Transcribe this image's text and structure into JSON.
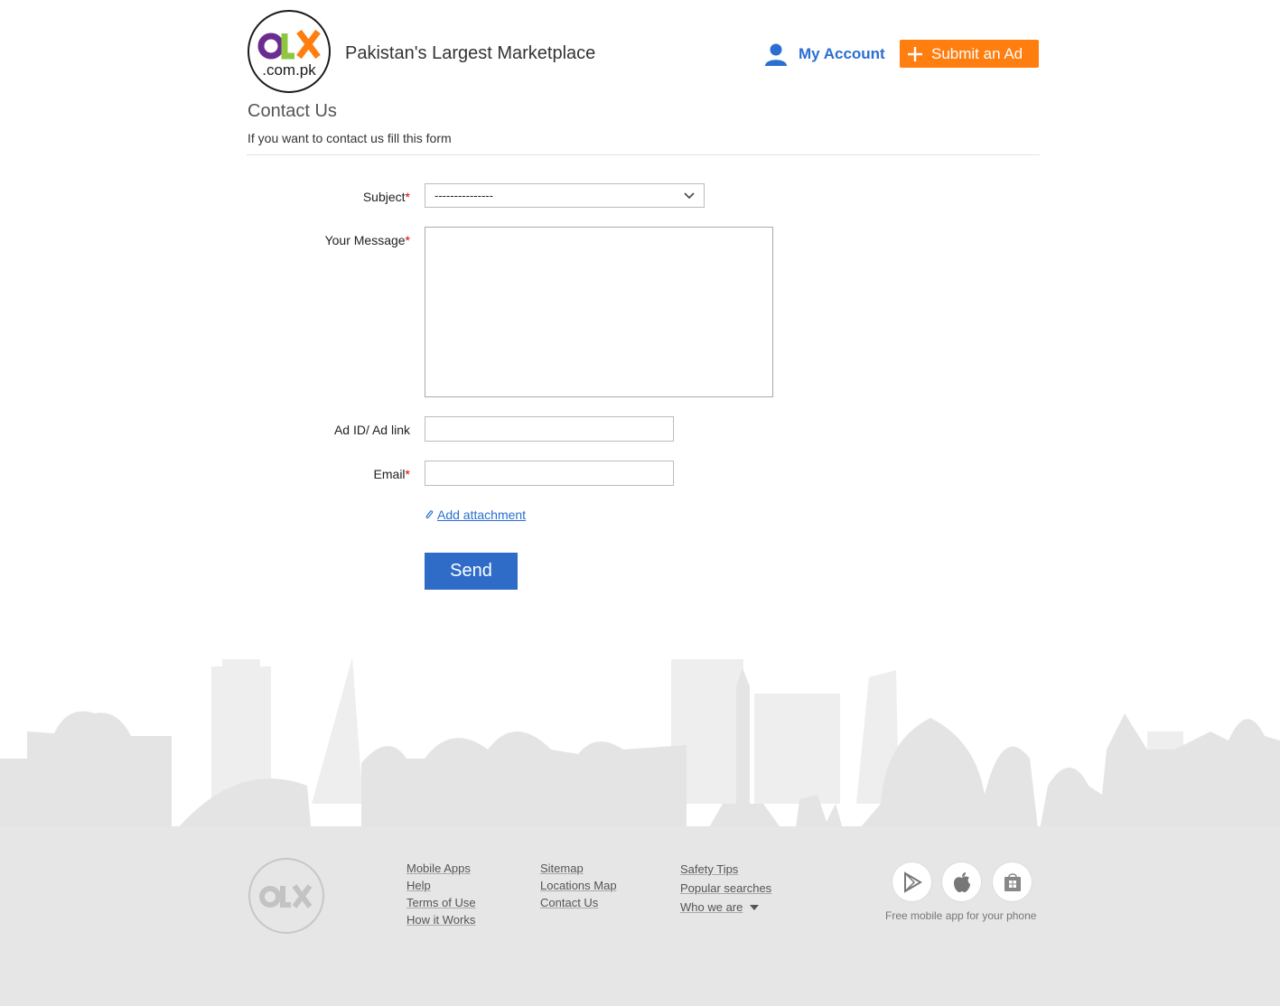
{
  "header": {
    "logo_brand": "OLX",
    "logo_domain": ".com.pk",
    "tagline": "Pakistan's Largest Marketplace",
    "account_label": "My Account",
    "account_icon": "user-icon",
    "submit_label": "Submit an Ad",
    "submit_icon": "plus-icon"
  },
  "page": {
    "title": "Contact Us",
    "subtitle": "If you want to contact us fill this form"
  },
  "form": {
    "subject_label": "Subject",
    "subject_value": "---------------",
    "message_label": "Your Message",
    "adid_label": "Ad ID/ Ad link",
    "email_label": "Email",
    "required_mark": "*",
    "attachment_label": "Add attachment",
    "send_label": "Send"
  },
  "footer": {
    "col1": [
      "Mobile Apps",
      "Help",
      "Terms of Use",
      "How it Works"
    ],
    "col2": [
      "Sitemap",
      "Locations Map",
      "Contact Us"
    ],
    "col3": [
      "Safety Tips",
      "Popular searches",
      "Who we are"
    ],
    "apps": [
      "google-play-icon",
      "apple-icon",
      "windows-store-icon"
    ],
    "apps_caption": "Free mobile app for your phone"
  },
  "colors": {
    "accent_blue": "#2a6fd1",
    "submit_orange": "#ff7e10",
    "send_blue": "#2f6cc7",
    "footer_gray": "#e6e6e6"
  }
}
